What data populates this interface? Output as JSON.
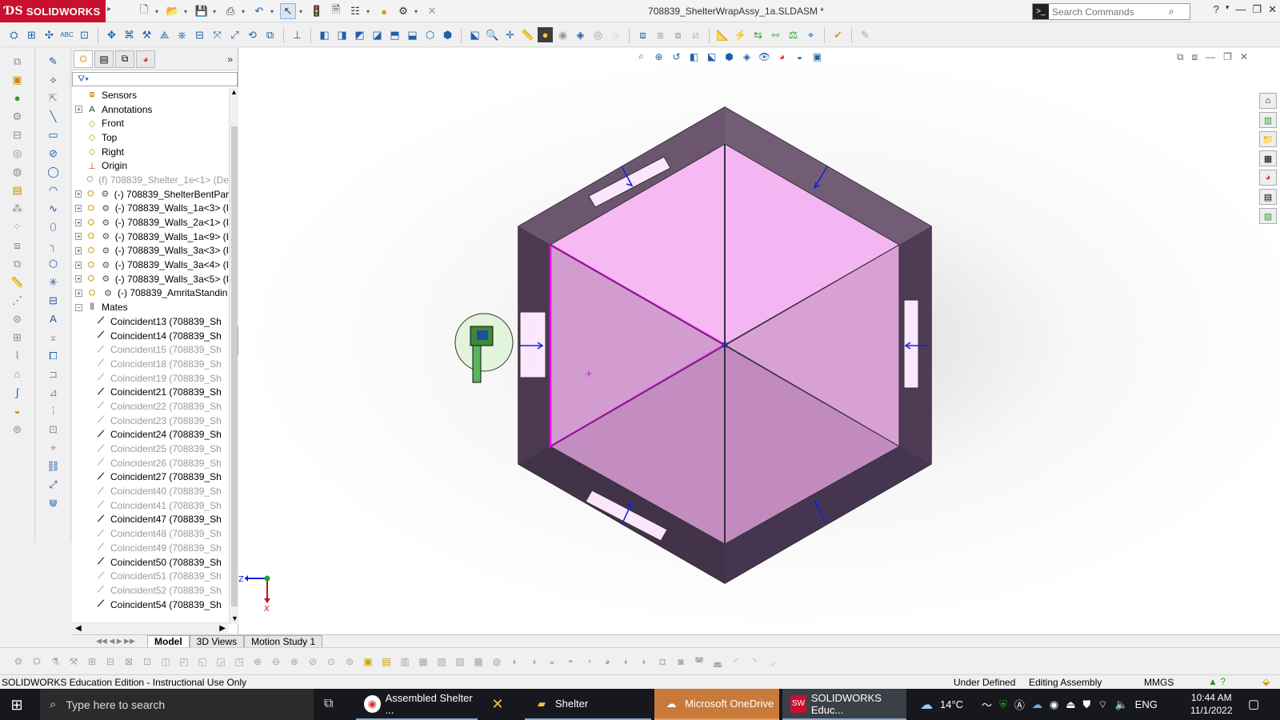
{
  "app": {
    "brand": "SOLIDWORKS",
    "document_title": "708839_ShelterWrapAssy_1a.SLDASM *",
    "search_placeholder": "Search Commands"
  },
  "colors": {
    "brand_red": "#c8102e",
    "top_face": "#f6b9f4",
    "side_face": "#c98dc6",
    "frame": "#5a4660",
    "mate_arrow": "#1024d8"
  },
  "feature_tree": {
    "items": [
      {
        "label": "Sensors",
        "icon": "sensors-icon",
        "expandable": false,
        "dim": false
      },
      {
        "label": "Annotations",
        "icon": "annotations-icon",
        "expandable": true,
        "dim": false
      },
      {
        "label": "Front",
        "icon": "plane-icon",
        "expandable": false,
        "dim": false
      },
      {
        "label": "Top",
        "icon": "plane-icon",
        "expandable": false,
        "dim": false
      },
      {
        "label": "Right",
        "icon": "plane-icon",
        "expandable": false,
        "dim": false
      },
      {
        "label": "Origin",
        "icon": "origin-icon",
        "expandable": false,
        "dim": false
      },
      {
        "label": "(f) 708839_Shelter_1e<1> (De",
        "icon": "part-icon",
        "expandable": false,
        "dim": true
      },
      {
        "label": "(-) 708839_ShelterBentPar",
        "icon": "subassembly-icon",
        "expandable": true,
        "dim": false
      },
      {
        "label": "(-) 708839_Walls_1a<3> (I",
        "icon": "subassembly-icon",
        "expandable": true,
        "dim": false
      },
      {
        "label": "(-) 708839_Walls_2a<1> (I",
        "icon": "subassembly-icon",
        "expandable": true,
        "dim": false
      },
      {
        "label": "(-) 708839_Walls_1a<9> (I",
        "icon": "subassembly-icon",
        "expandable": true,
        "dim": false
      },
      {
        "label": "(-) 708839_Walls_3a<3> (I",
        "icon": "subassembly-icon",
        "expandable": true,
        "dim": false
      },
      {
        "label": "(-) 708839_Walls_3a<4> (I",
        "icon": "subassembly-icon",
        "expandable": true,
        "dim": false
      },
      {
        "label": "(-) 708839_Walls_3a<5> (I",
        "icon": "subassembly-icon",
        "expandable": true,
        "dim": false
      },
      {
        "label": "(-) 708839_AmritaStandin",
        "icon": "subassembly-icon",
        "expandable": true,
        "dim": false
      },
      {
        "label": "Mates",
        "icon": "mates-icon",
        "expandable": true,
        "expanded": true,
        "dim": false
      }
    ],
    "mates": [
      {
        "label": "Coincident13 (708839_Sh",
        "dim": false
      },
      {
        "label": "Coincident14 (708839_Sh",
        "dim": false
      },
      {
        "label": "Coincident15 (708839_Sh",
        "dim": true
      },
      {
        "label": "Coincident18 (708839_Sh",
        "dim": true
      },
      {
        "label": "Coincident19 (708839_Sh",
        "dim": true
      },
      {
        "label": "Coincident21 (708839_Sh",
        "dim": false
      },
      {
        "label": "Coincident22 (708839_Sh",
        "dim": true
      },
      {
        "label": "Coincident23 (708839_Sh",
        "dim": true
      },
      {
        "label": "Coincident24 (708839_Sh",
        "dim": false
      },
      {
        "label": "Coincident25 (708839_Sh",
        "dim": true
      },
      {
        "label": "Coincident26 (708839_Sh",
        "dim": true
      },
      {
        "label": "Coincident27 (708839_Sh",
        "dim": false
      },
      {
        "label": "Coincident40 (708839_Sh",
        "dim": true
      },
      {
        "label": "Coincident41 (708839_Sh",
        "dim": true
      },
      {
        "label": "Coincident47 (708839_Sh",
        "dim": false
      },
      {
        "label": "Coincident48 (708839_Sh",
        "dim": true
      },
      {
        "label": "Coincident49 (708839_Sh",
        "dim": true
      },
      {
        "label": "Coincident50 (708839_Sh",
        "dim": false
      },
      {
        "label": "Coincident51 (708839_Sh",
        "dim": true
      },
      {
        "label": "Coincident52 (708839_Sh",
        "dim": true
      },
      {
        "label": "Coincident54 (708839_Sh",
        "dim": false
      }
    ]
  },
  "triad": {
    "z_label": "Z",
    "x_label": "X"
  },
  "model_tabs": [
    {
      "label": "Model",
      "active": true
    },
    {
      "label": "3D Views",
      "active": false
    },
    {
      "label": "Motion Study 1",
      "active": false
    }
  ],
  "status": {
    "edition": "SOLIDWORKS Education Edition - Instructional Use Only",
    "state": "Under Defined",
    "mode": "Editing Assembly",
    "units": "MMGS"
  },
  "taskbar": {
    "search_placeholder": "Type here to search",
    "tasks": [
      {
        "label": "Assembled Shelter ...",
        "icon": "chrome-icon"
      },
      {
        "label": "",
        "icon": "x-app-icon"
      },
      {
        "label": "Shelter",
        "icon": "folder-icon"
      },
      {
        "label": "Microsoft OneDrive",
        "icon": "onedrive-icon"
      },
      {
        "label": "SOLIDWORKS Educ...",
        "icon": "solidworks-icon"
      }
    ],
    "weather": "14°C",
    "language": "ENG",
    "time": "10:44 AM",
    "date": "11/1/2022"
  }
}
